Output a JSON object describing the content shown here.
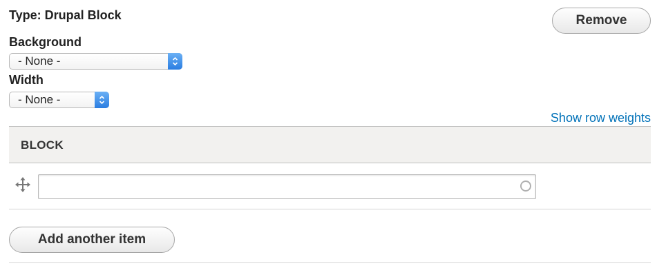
{
  "paragraph": {
    "type_label": "Type: Drupal Block",
    "remove_label": "Remove"
  },
  "fields": {
    "background": {
      "label": "Background",
      "selected": "- None -"
    },
    "width": {
      "label": "Width",
      "selected": "- None -"
    }
  },
  "table": {
    "row_weights_link": "Show row weights",
    "header": "BLOCK",
    "rows": [
      {
        "block_value": "",
        "drag_icon": "move-cross-icon",
        "autocomplete_icon": "throbber-circle-icon"
      }
    ]
  },
  "actions": {
    "add_label": "Add another item"
  },
  "colors": {
    "link": "#0071b8",
    "select_arrow": "#2a7de1",
    "header_bg": "#f2f1ef"
  }
}
